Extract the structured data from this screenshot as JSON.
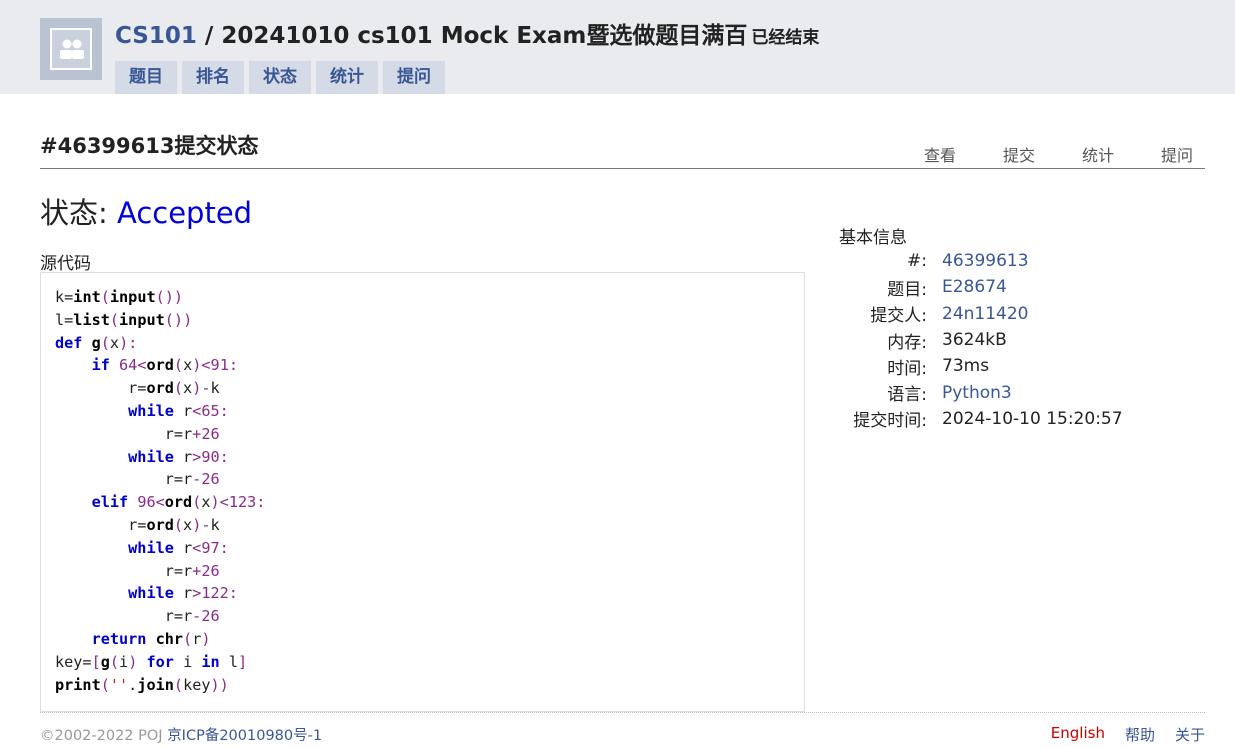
{
  "header": {
    "course": "CS101",
    "separator": " / ",
    "contest": "20241010 cs101 Mock Exam暨选做题目满百",
    "ended": "已经结束",
    "tabs": [
      "题目",
      "排名",
      "状态",
      "统计",
      "提问"
    ]
  },
  "page": {
    "title": "#46399613提交状态",
    "sub_nav": [
      "查看",
      "提交",
      "统计",
      "提问"
    ],
    "status_label": "状态: ",
    "status_value": "Accepted",
    "source_label": "源代码"
  },
  "info": {
    "title": "基本信息",
    "rows": [
      {
        "key": "#:",
        "value": "46399613"
      },
      {
        "key": "题目:",
        "value": "E28674"
      },
      {
        "key": "提交人:",
        "value": "24n11420"
      },
      {
        "key": "内存:",
        "value": "3624kB"
      },
      {
        "key": "时间:",
        "value": "73ms"
      },
      {
        "key": "语言:",
        "value": "Python3"
      },
      {
        "key": "提交时间:",
        "value": "2024-10-10 15:20:57"
      }
    ]
  },
  "code_lines": [
    "k=int(input())",
    "l=list(input())",
    "def g(x):",
    "    if 64<ord(x)<91:",
    "        r=ord(x)-k",
    "        while r<65:",
    "            r=r+26",
    "        while r>90:",
    "            r=r-26",
    "    elif 96<ord(x)<123:",
    "        r=ord(x)-k",
    "        while r<97:",
    "            r=r+26",
    "        while r>122:",
    "            r=r-26",
    "    return chr(r)",
    "key=[g(i) for i in l]",
    "print(''.join(key))"
  ],
  "footer": {
    "copyright": "©2002-2022 POJ ",
    "icp": "京ICP备20010980号-1",
    "links": [
      "English",
      "帮助",
      "关于"
    ]
  },
  "colors": {
    "accent": "#3a5795",
    "accepted": "#0000dd",
    "header_bg": "#e9ebef",
    "tab_bg": "#d4dae6"
  }
}
